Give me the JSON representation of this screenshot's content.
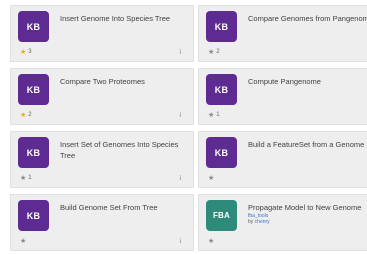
{
  "colors": {
    "kb_tile": "#5e2b92",
    "fba_tile": "#2e8b7a",
    "star_active": "#f5a623",
    "star_inactive": "#888888",
    "link": "#3a78c2"
  },
  "cards": [
    {
      "tile": "KB",
      "title": "Insert Genome Into Species Tree",
      "stars": "3",
      "starred": true,
      "info_icon": "info-icon"
    },
    {
      "tile": "KB",
      "title": "Compare Genomes from Pangenome",
      "stars": "2",
      "starred": false,
      "info_icon": "info-icon"
    },
    {
      "tile": "KB",
      "title": "Compare Two Proteomes",
      "stars": "2",
      "starred": true,
      "info_icon": "info-icon"
    },
    {
      "tile": "KB",
      "title": "Compute Pangenome",
      "stars": "1",
      "starred": false,
      "info_icon": "info-icon"
    },
    {
      "tile": "KB",
      "title": "Insert Set of Genomes Into Species Tree",
      "stars": "1",
      "starred": false,
      "info_icon": "info-icon"
    },
    {
      "tile": "KB",
      "title": "Build a FeatureSet from a Genome",
      "stars": "",
      "starred": false,
      "info_icon": "info-icon"
    },
    {
      "tile": "KB",
      "title": "Build Genome Set From Tree",
      "stars": "",
      "starred": false,
      "info_icon": "info-icon"
    },
    {
      "tile": "FBA",
      "title": "Propagate Model to New Genome",
      "module": "fba_tools",
      "author_prefix": "by",
      "author": "chenry",
      "stars": "",
      "starred": false,
      "info_icon": "info-icon"
    }
  ],
  "info_glyph": "i",
  "star_glyph": "★"
}
